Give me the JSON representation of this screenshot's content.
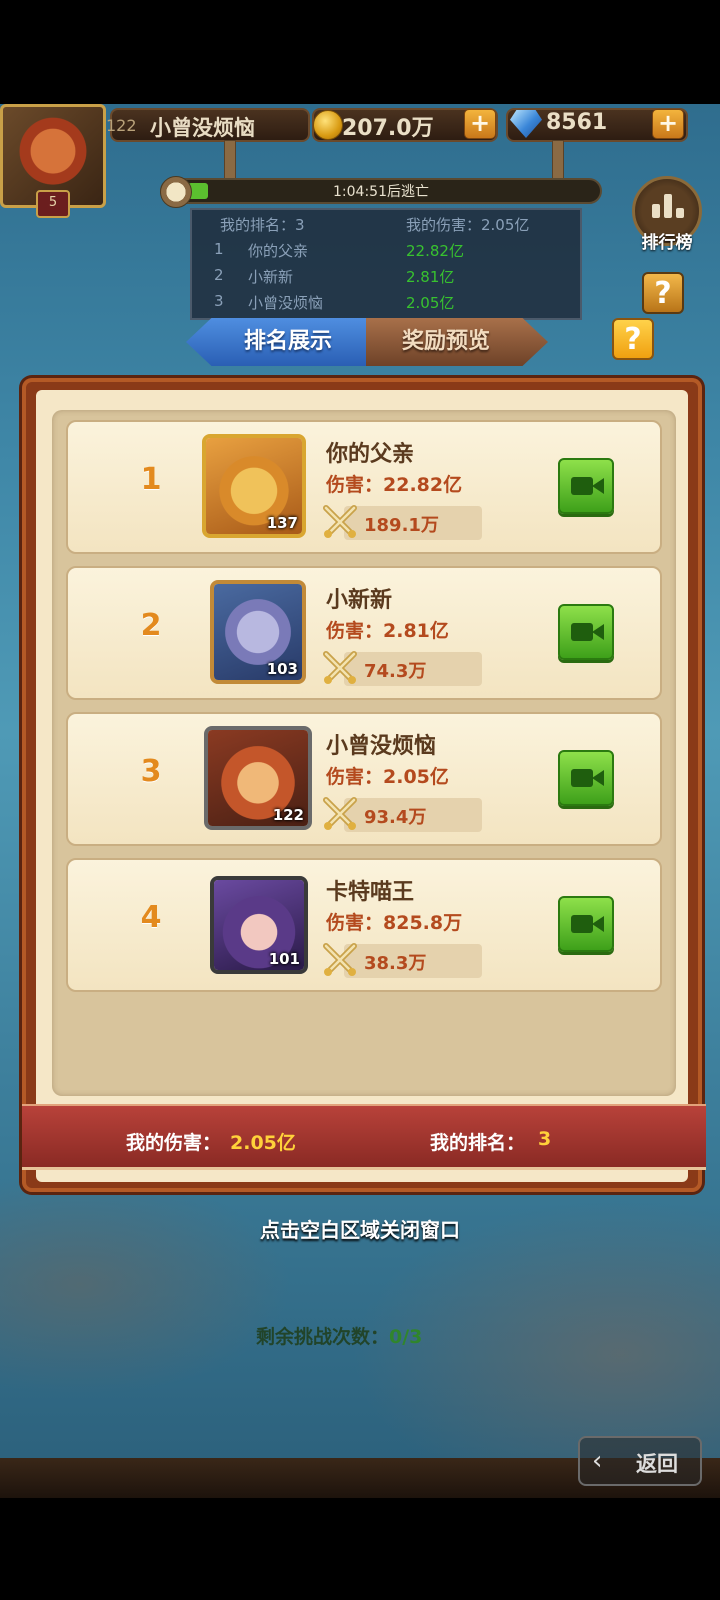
{
  "player": {
    "level": "122",
    "name": "小曾没烦恼",
    "vip": "5",
    "gold": "207.0万",
    "gems": "8561",
    "plus": "+"
  },
  "boss_timer": {
    "text": "1:04:51后逃亡",
    "progress_fraction": 0.05
  },
  "mini_board": {
    "my_rank": "我的排名：3",
    "my_damage": "我的伤害：2.05亿",
    "rows": [
      {
        "rank": "1",
        "name": "你的父亲",
        "value": "22.82亿"
      },
      {
        "rank": "2",
        "name": "小新新",
        "value": "2.81亿"
      },
      {
        "rank": "3",
        "name": "小曾没烦恼",
        "value": "2.05亿"
      }
    ]
  },
  "leaderboard_button": {
    "label": "排行榜"
  },
  "help": {
    "label": "?"
  },
  "tabs": {
    "ranking": "排名展示",
    "rewards": "奖励预览"
  },
  "rankings": [
    {
      "rank": "1",
      "name": "你的父亲",
      "damage": "伤害：22.82亿",
      "power": "189.1万",
      "level": "137"
    },
    {
      "rank": "2",
      "name": "小新新",
      "damage": "伤害：2.81亿",
      "power": "74.3万",
      "level": "103"
    },
    {
      "rank": "3",
      "name": "小曾没烦恼",
      "damage": "伤害：2.05亿",
      "power": "93.4万",
      "level": "122"
    },
    {
      "rank": "4",
      "name": "卡特喵王",
      "damage": "伤害：825.8万",
      "power": "38.3万",
      "level": "101"
    }
  ],
  "footer": {
    "my_damage_label": "我的伤害：",
    "my_damage_value": "2.05亿",
    "my_rank_label": "我的排名：",
    "my_rank_value": "3"
  },
  "close_hint": "点击空白区域关闭窗口",
  "remaining": {
    "label": "剩余挑战次数：",
    "count": "0/3"
  },
  "back_button": {
    "label": "返回"
  },
  "colors": {
    "accent_orange": "#e38a1e",
    "damage_red": "#b44a1e",
    "video_green": "#3ea01a",
    "tab_blue": "#2a5fb4",
    "ribbon_red": "#8a2a24",
    "highlight_yellow": "#ffd23a"
  },
  "icons": {
    "coin": "coin-icon",
    "gem": "gem-icon",
    "swords": "crossed-swords-icon",
    "video": "video-camera-icon",
    "back": "back-arrow-icon",
    "clock": "clock-icon",
    "leaderboard": "bar-chart-icon"
  }
}
